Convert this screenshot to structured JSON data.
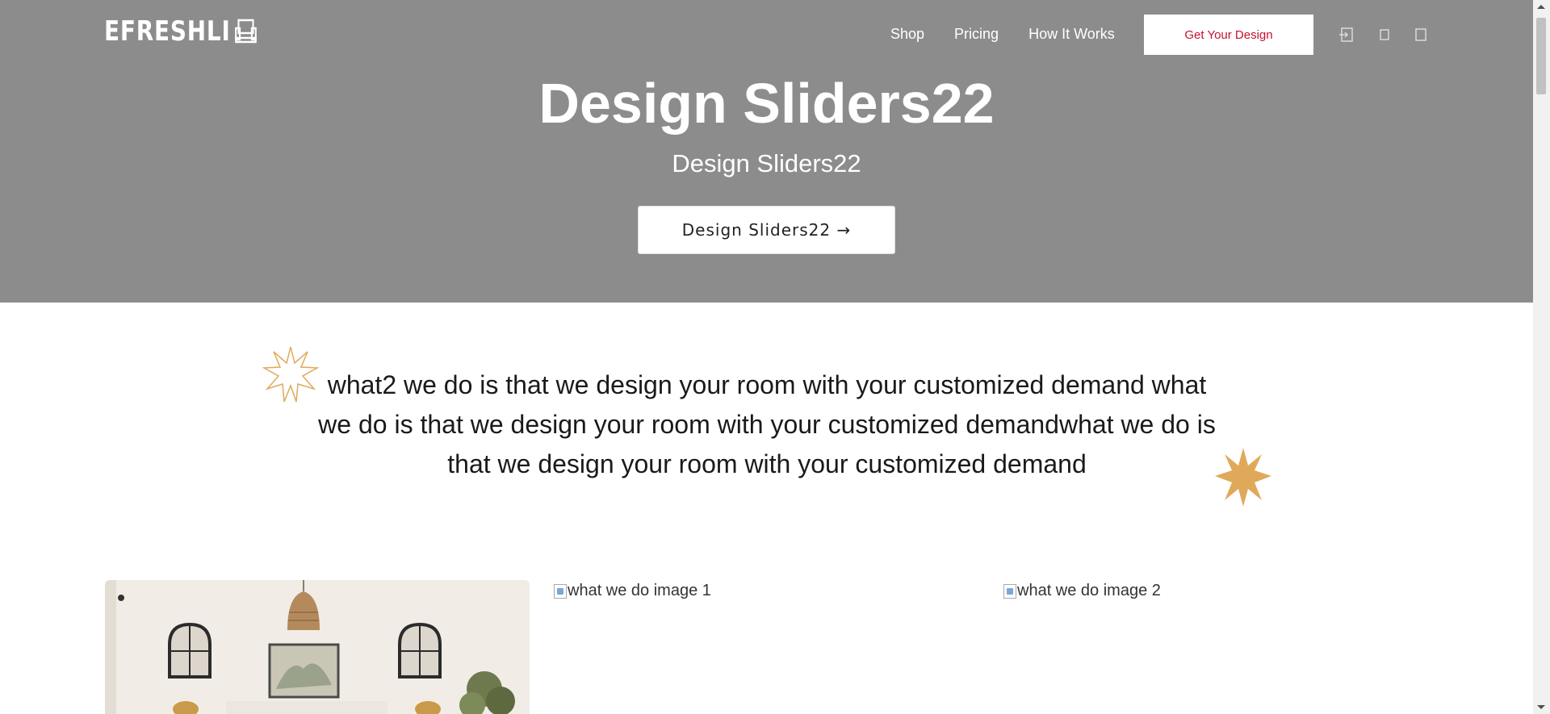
{
  "header": {
    "logo_text": "EFRESHLI",
    "nav": [
      {
        "label": "Shop"
      },
      {
        "label": "Pricing"
      },
      {
        "label": "How It Works"
      }
    ],
    "cta_label": "Get Your Design",
    "icons": [
      "login-icon",
      "cart-icon",
      "account-icon"
    ]
  },
  "hero": {
    "title": "Design Sliders22",
    "subtitle": "Design Sliders22",
    "button_label": "Design Sliders22 →"
  },
  "what_we_do": {
    "text": "what2 we do is that we design your room with your customized demand what we do is that we design your room with your customized demandwhat we do is that we design your room with your customized demand"
  },
  "images": {
    "alt_1": "what we do image 1",
    "alt_2": "what we do image 2"
  },
  "colors": {
    "hero_bg": "#8c8c8c",
    "accent_red": "#c8102e",
    "star_gold": "#e0a95a"
  }
}
